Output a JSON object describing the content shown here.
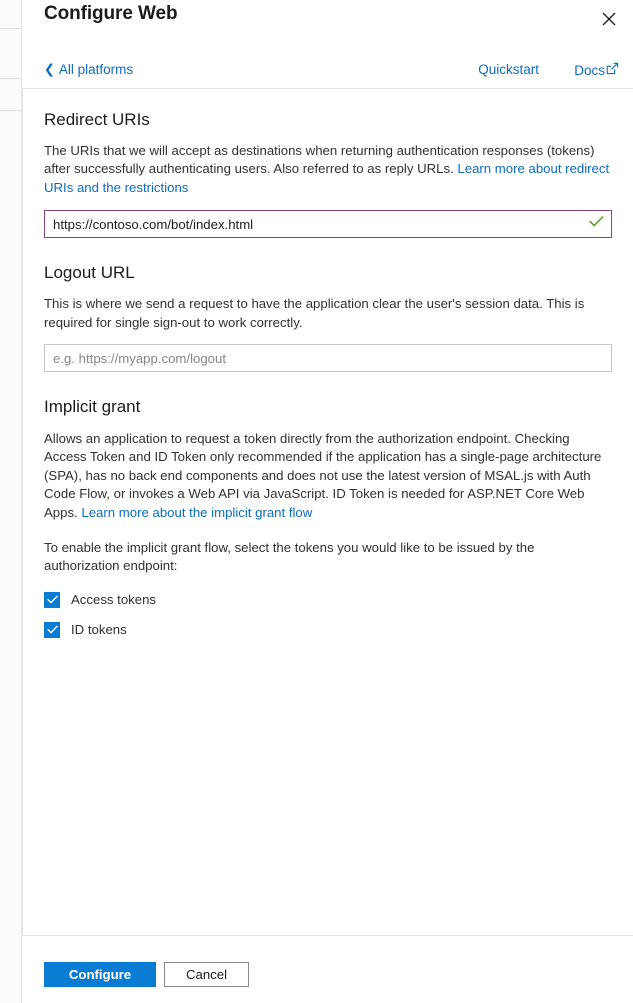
{
  "header": {
    "title": "Configure Web",
    "close_icon": "close-icon",
    "back_link": "All platforms",
    "back_chevron": "chevron-left-icon",
    "quickstart_link": "Quickstart",
    "docs_link": "Docs",
    "docs_external_icon": "external-link-icon"
  },
  "redirect_uris": {
    "heading": "Redirect URIs",
    "description_part1": "The URIs that we will accept as destinations when returning authentication responses (tokens) after successfully authenticating users. Also referred to as reply URLs. ",
    "description_link": "Learn more about redirect URIs and the restrictions",
    "input_value": "https://contoso.com/bot/index.html",
    "valid_icon": "checkmark-icon"
  },
  "logout_url": {
    "heading": "Logout URL",
    "description": "This is where we send a request to have the application clear the user's session data. This is required for single sign-out to work correctly.",
    "placeholder": "e.g. https://myapp.com/logout",
    "input_value": ""
  },
  "implicit_grant": {
    "heading": "Implicit grant",
    "description_part1": "Allows an application to request a token directly from the authorization endpoint. Checking Access Token and ID Token only recommended if the application has a single-page architecture (SPA), has no back end components and does not use the latest version of MSAL.js with Auth Code Flow, or invokes a Web API via JavaScript. ID Token is needed for ASP.NET Core Web Apps. ",
    "description_link": "Learn more about the implicit grant flow",
    "instruction": "To enable the implicit grant flow, select the tokens you would like to be issued by the authorization endpoint:",
    "checkboxes": [
      {
        "label": "Access tokens",
        "checked": true
      },
      {
        "label": "ID tokens",
        "checked": true
      }
    ]
  },
  "footer": {
    "primary_button": "Configure",
    "secondary_button": "Cancel"
  },
  "colors": {
    "link": "#0f6cbd",
    "primary": "#0b7cd4",
    "focus_border": "#8a3f8a",
    "valid_check": "#5a9e2f"
  }
}
